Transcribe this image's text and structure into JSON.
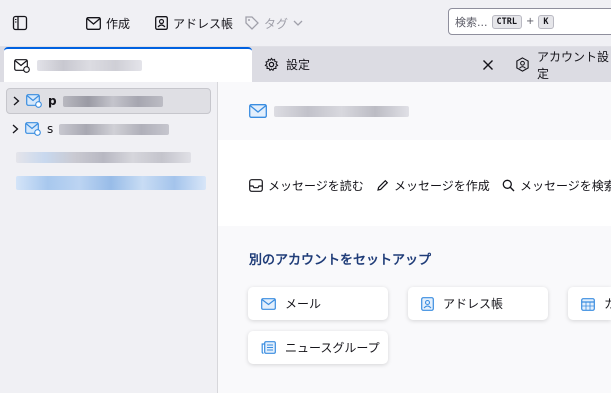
{
  "toolbar": {
    "folder_pane_toggle": "folder-pane-icon",
    "compose_label": "作成",
    "address_book_label": "アドレス帳",
    "tag_label": "タグ",
    "search_placeholder": "検索...",
    "search_key1": "CTRL",
    "search_plus": "+",
    "search_key2": "K"
  },
  "tabs": [
    {
      "label": "",
      "icon": "mail-account-icon",
      "active": true
    },
    {
      "label": "設定",
      "icon": "gear-icon",
      "active": false
    },
    {
      "label": "アカウント設定",
      "icon": "account-settings-icon",
      "active": false
    }
  ],
  "folder_pane": {
    "accounts": [
      {
        "label": "p",
        "selected": true
      },
      {
        "label": "s",
        "selected": false
      }
    ]
  },
  "main": {
    "actions": [
      {
        "label": "メッセージを読む",
        "icon": "inbox-icon"
      },
      {
        "label": "メッセージを作成",
        "icon": "pencil-icon"
      },
      {
        "label": "メッセージを検索",
        "icon": "search-icon"
      }
    ],
    "setup_title": "別のアカウントをセットアップ",
    "setup_cards": [
      {
        "label": "メール",
        "icon": "mail-icon"
      },
      {
        "label": "アドレス帳",
        "icon": "address-book-icon"
      },
      {
        "label": "カ",
        "icon": "calendar-icon"
      },
      {
        "label": "ニュースグループ",
        "icon": "newsgroup-icon"
      }
    ]
  },
  "colors": {
    "accent": "#0061e0",
    "setup_title": "#1f3c78",
    "icon_blue": "#3a8de0"
  }
}
